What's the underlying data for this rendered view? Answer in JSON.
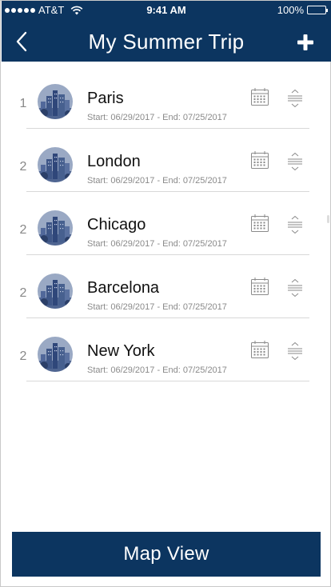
{
  "status_bar": {
    "carrier": "AT&T",
    "time": "9:41 AM",
    "battery": "100%",
    "battery_level": 1.0
  },
  "nav": {
    "title": "My Summer Trip",
    "back_icon": "chevron-left-icon",
    "add_icon": "plus-icon"
  },
  "trips": [
    {
      "number": "1",
      "city": "Paris",
      "dates": "Start: 06/29/2017 - End: 07/25/2017"
    },
    {
      "number": "2",
      "city": "London",
      "dates": "Start: 06/29/2017 - End: 07/25/2017"
    },
    {
      "number": "2",
      "city": "Chicago",
      "dates": "Start: 06/29/2017 - End: 07/25/2017"
    },
    {
      "number": "2",
      "city": "Barcelona",
      "dates": "Start: 06/29/2017 - End: 07/25/2017"
    },
    {
      "number": "2",
      "city": "New York",
      "dates": "Start: 06/29/2017 - End: 07/25/2017"
    }
  ],
  "map_button": {
    "label": "Map View"
  },
  "colors": {
    "brand": "#0c3560",
    "divider": "#d8d8d8",
    "muted": "#8a8a8a"
  }
}
